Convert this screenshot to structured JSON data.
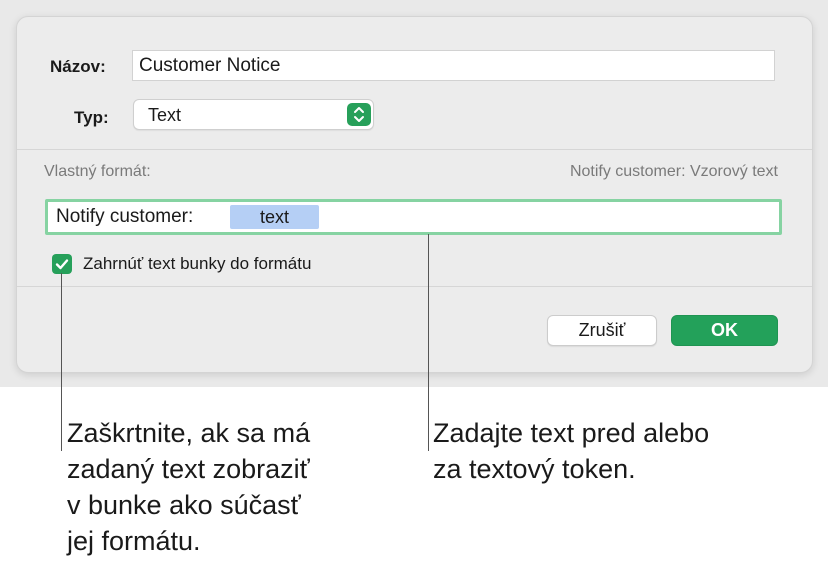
{
  "dialog": {
    "name_label": "Názov:",
    "name_value": "Customer Notice",
    "type_label": "Typ:",
    "type_value": "Text",
    "custom_format_label": "Vlastný formát:",
    "preview_text": "Notify customer: Vzorový text",
    "format_prefix": "Notify customer:",
    "format_token": "text",
    "include_checkbox_label": "Zahrnúť text bunky do formátu",
    "include_checked": true,
    "cancel_label": "Zrušiť",
    "ok_label": "OK"
  },
  "callouts": {
    "left": [
      "Zaškrtnite, ak sa má",
      "zadaný text zobraziť",
      "v bunke ako súčasť",
      "jej formátu."
    ],
    "right": [
      "Zadajte text pred alebo",
      "za textový token."
    ]
  },
  "colors": {
    "accent_green": "#23a15a",
    "focus_ring": "#86d3a2",
    "token_blue": "#b5cff5"
  },
  "icons": {
    "stepper": "select-stepper-icon",
    "checkbox": "checkmark-icon"
  }
}
